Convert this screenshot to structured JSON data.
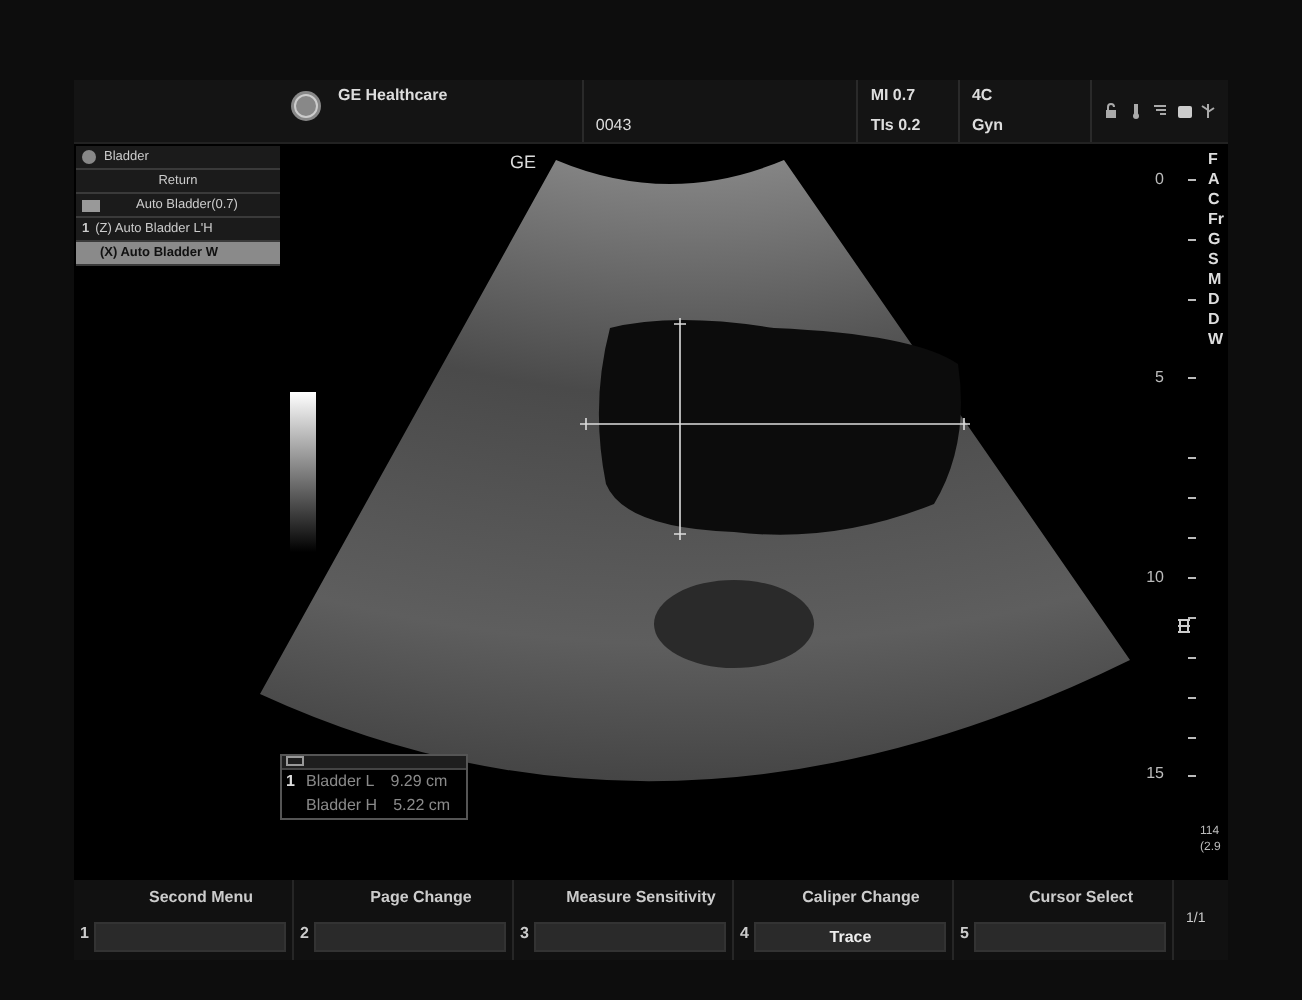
{
  "header": {
    "logo_text": "GE Healthcare",
    "patient_id": "0043",
    "mi": "MI 0.7",
    "tis": "TIs 0.2",
    "probe": "4C",
    "preset": "Gyn"
  },
  "menu": {
    "title": "Bladder",
    "items": [
      {
        "kind": "button",
        "label": "Return",
        "selected": false
      },
      {
        "kind": "folder",
        "label": "Auto Bladder(0.7)",
        "selected": false
      },
      {
        "kind": "item",
        "index": "1",
        "label": "(Z)  Auto Bladder L'H",
        "selected": false
      },
      {
        "kind": "item",
        "label": "(X)  Auto Bladder W",
        "selected": true
      }
    ]
  },
  "image": {
    "orientation_mark": "GE",
    "depth_labels": [
      "0",
      "5",
      "10",
      "15"
    ],
    "side_labels": [
      "F",
      "A",
      "C",
      "Fr",
      "G",
      "S",
      "M",
      "D",
      "D",
      "W"
    ],
    "corner_labels": [
      "114",
      "(2.9"
    ]
  },
  "measurements": {
    "rows": [
      {
        "index": "1",
        "label": "Bladder L",
        "value": "9.29 cm"
      },
      {
        "label": "Bladder H",
        "value": "5.22 cm"
      }
    ]
  },
  "softkeys": [
    {
      "number": "1",
      "label": "Second Menu"
    },
    {
      "number": "2",
      "label": "Page Change"
    },
    {
      "number": "3",
      "label": "Measure Sensitivity"
    },
    {
      "number": "4",
      "label": "Caliper Change",
      "value": "Trace"
    },
    {
      "number": "5",
      "label": "Cursor Select"
    }
  ],
  "page_indicator": "1/1"
}
